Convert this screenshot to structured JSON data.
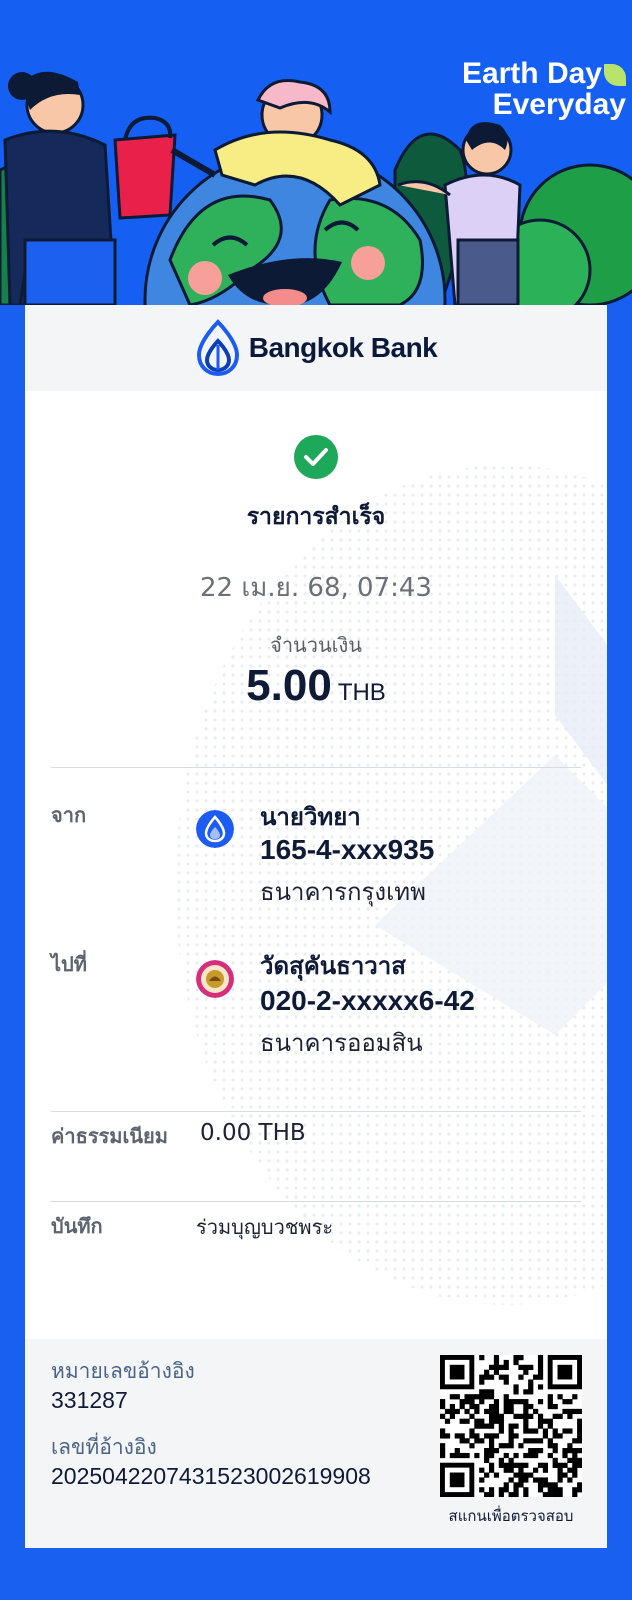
{
  "banner": {
    "line1": "Earth Day",
    "line2": "Everyday"
  },
  "header": {
    "bank_name": "Bangkok Bank"
  },
  "status": {
    "icon": "check-circle-icon",
    "text": "รายการสำเร็จ",
    "datetime": "22 เม.ย. 68, 07:43"
  },
  "amount": {
    "label": "จำนวนเงิน",
    "value": "5.00",
    "currency": "THB"
  },
  "from": {
    "label": "จาก",
    "name": "นายวิทยา",
    "account": "165-4-xxx935",
    "bank": "ธนาคารกรุงเทพ"
  },
  "to": {
    "label": "ไปที่",
    "name": "วัดสุคันธาวาส",
    "account": "020-2-xxxxx6-42",
    "bank": "ธนาคารออมสิน"
  },
  "fee": {
    "label": "ค่าธรรมเนียม",
    "value": "0.00 THB"
  },
  "note": {
    "label": "บันทึก",
    "value": "ร่วมบุญบวชพระ"
  },
  "footer": {
    "ref1_label": "หมายเลขอ้างอิง",
    "ref1_value": "331287",
    "ref2_label": "เลขที่อ้างอิง",
    "ref2_value": "2025042207431523002619908",
    "qr_caption": "สแกนเพื่อตรวจสอบ"
  },
  "colors": {
    "brand_blue": "#1a60f0",
    "success_green": "#1ea85a",
    "text_dark": "#0f1a36"
  }
}
